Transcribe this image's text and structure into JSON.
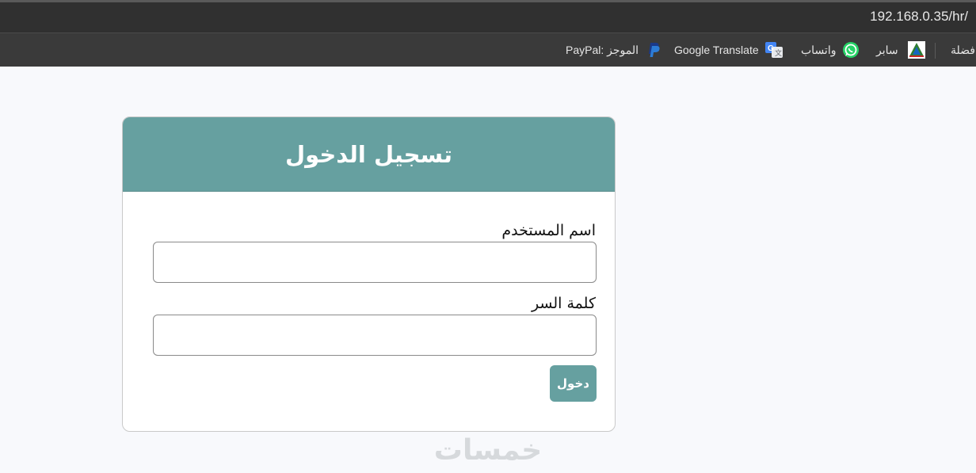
{
  "browser": {
    "url": "192.168.0.35/hr/",
    "bookmarks": [
      {
        "label": "فضلة",
        "icon": "bookmark-icon"
      },
      {
        "label": "سابر",
        "icon": "saber-logo-icon"
      },
      {
        "label": "واتساب",
        "icon": "whatsapp-icon"
      },
      {
        "label": "Google Translate",
        "icon": "google-translate-icon"
      },
      {
        "label": "PayPal: الموجز",
        "icon": "paypal-icon"
      }
    ]
  },
  "login": {
    "title": "تسجيل الدخول",
    "username_label": "اسم المستخدم",
    "username_value": "",
    "password_label": "كلمة السر",
    "password_value": "",
    "submit_label": "دخول"
  },
  "watermark": "خمسات",
  "colors": {
    "accent": "#66a0a0",
    "page_bg": "#f8f9fc",
    "chrome_bg": "#303030"
  }
}
